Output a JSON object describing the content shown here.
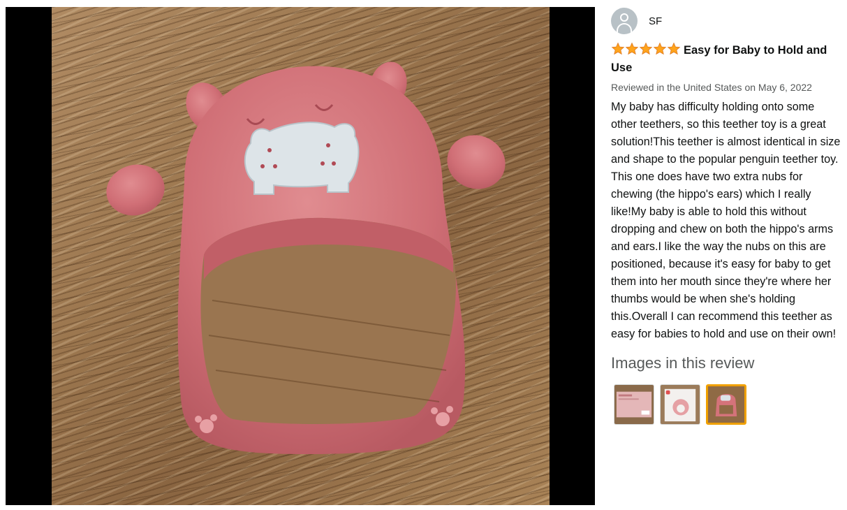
{
  "viewer": {
    "image_subject": "pink hippo teether"
  },
  "review": {
    "reviewer_name": "SF",
    "rating": 5,
    "title": "Easy for Baby to Hold and Use",
    "meta": "Reviewed in the United States on May 6, 2022",
    "body": "My baby has difficulty holding onto some other teethers, so this teether toy is a great solution!This teether is almost identical in size and shape to the popular penguin teether toy. This one does have two extra nubs for chewing (the hippo's ears) which I really like!My baby is able to hold this without dropping and chew on both the hippo's arms and ears.I like the way the nubs on this are positioned, because it's easy for baby to get them into her mouth since they're where her thumbs would be when she's holding this.Overall I can recommend this teether as easy for babies to hold and use on their own!",
    "images_heading": "Images in this review",
    "selected_thumbnail": 3
  },
  "colors": {
    "star": "#ffa41c",
    "selected_border": "#f0a000",
    "teether_pink": "#d4737a",
    "hippo_badge": "#dde4e8"
  }
}
